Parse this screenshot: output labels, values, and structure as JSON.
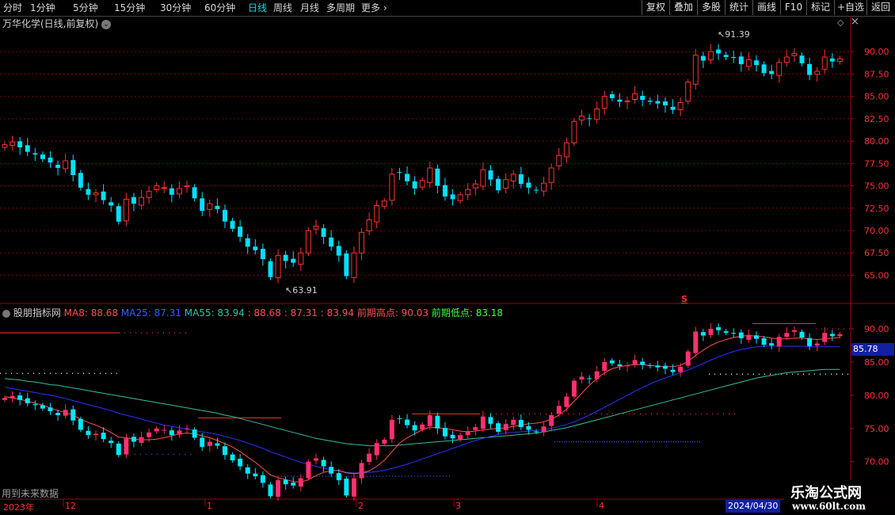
{
  "toolbar": {
    "periods": [
      "分时",
      "1分钟",
      "5分钟",
      "15分钟",
      "30分钟",
      "60分钟",
      "日线",
      "周线",
      "月线",
      "多周期",
      "更多"
    ],
    "active": "日线",
    "right_buttons": [
      "复权",
      "叠加",
      "多股",
      "统计",
      "画线",
      "F10",
      "标记",
      "+自选",
      "返回"
    ]
  },
  "main_panel": {
    "title": "万华化学(日线,前复权)",
    "high_label": "91.39",
    "low_label": "63.91",
    "s_marker": "S"
  },
  "sub_panel": {
    "indicator_name": "股朋指标网",
    "ma8_label": "MA8: 88.68",
    "ma25_label": "MA25: 87.31",
    "ma55_label": "MA55: 83.94",
    "extra1": ": 88.68",
    "extra2": ": 87.31",
    "extra3": ": 83.94",
    "prev_high_label": "前期高点: 90.03",
    "prev_low_label": "前期低点: 83.18",
    "price_box": "85.78",
    "future_note": "用到未来数据"
  },
  "time_axis": {
    "labels": [
      "2023年",
      "12",
      "1",
      "2",
      "3",
      "4"
    ],
    "current_date": "2024/04/30"
  },
  "watermark": {
    "line1": "乐淘公式网",
    "line2": "www.60lt.com"
  },
  "colors": {
    "up": "#ff3030",
    "down": "#00e0ff",
    "ma8": "#ff5050",
    "ma25": "#3030ff",
    "ma55": "#30c0a0",
    "grid": "#800000"
  },
  "chart_data": {
    "type": "candlestick",
    "main_yaxis": {
      "ticks": [
        65.0,
        67.5,
        70.0,
        72.5,
        75.0,
        77.5,
        80.0,
        82.5,
        85.0,
        87.5,
        90.0
      ],
      "ylim": [
        63.0,
        92.5
      ]
    },
    "sub_yaxis": {
      "ticks": [
        70.0,
        75.0,
        80.0,
        85.0,
        90.0
      ],
      "ylim": [
        66.5,
        91.8
      ]
    },
    "closes": [
      79.6,
      79.9,
      79.3,
      78.8,
      78.5,
      78.0,
      77.6,
      77.0,
      77.8,
      76.2,
      74.8,
      74.0,
      74.2,
      73.4,
      72.8,
      71.0,
      73.5,
      73.0,
      73.7,
      74.4,
      75.0,
      74.8,
      74.0,
      74.7,
      75.0,
      73.6,
      72.2,
      73.0,
      72.4,
      71.0,
      70.2,
      69.3,
      68.2,
      67.8,
      66.8,
      64.8,
      67.2,
      66.6,
      66.4,
      67.5,
      70.0,
      70.5,
      69.3,
      68.2,
      67.2,
      64.9,
      67.5,
      69.8,
      71.2,
      72.8,
      73.3,
      76.3,
      76.5,
      75.5,
      74.7,
      75.6,
      77.0,
      75.0,
      73.8,
      73.5,
      74.0,
      74.6,
      75.2,
      76.8,
      75.7,
      74.5,
      75.7,
      76.3,
      75.2,
      74.8,
      74.5,
      75.3,
      77.0,
      78.4,
      79.8,
      82.2,
      82.8,
      82.5,
      83.6,
      85.0,
      84.8,
      84.4,
      84.5,
      85.3,
      84.6,
      84.4,
      84.2,
      84.0,
      83.5,
      84.3,
      86.6,
      89.6,
      89.0,
      90.0,
      89.8,
      89.4,
      89.3,
      88.6,
      89.1,
      88.5,
      87.6,
      87.5,
      88.8,
      89.4,
      89.8,
      88.7,
      87.4,
      87.8,
      89.4,
      88.9,
      89.2
    ],
    "ma8": [
      79.8,
      79.6,
      79.4,
      79.1,
      78.8,
      78.5,
      78.1,
      77.7,
      77.4,
      77.0,
      76.4,
      75.9,
      75.5,
      75.0,
      74.4,
      73.7,
      73.6,
      73.4,
      73.3,
      73.3,
      73.4,
      73.6,
      73.9,
      74.2,
      74.3,
      74.2,
      73.9,
      73.6,
      73.2,
      72.7,
      72.2,
      71.5,
      70.7,
      69.9,
      69.0,
      68.0,
      67.6,
      67.3,
      67.0,
      66.9,
      67.3,
      67.9,
      68.4,
      68.6,
      68.7,
      68.3,
      68.2,
      68.3,
      68.6,
      69.3,
      70.2,
      71.5,
      72.8,
      73.6,
      74.2,
      74.8,
      75.2,
      75.1,
      75.0,
      74.8,
      74.6,
      74.5,
      74.6,
      74.8,
      74.9,
      75.0,
      75.1,
      75.3,
      75.5,
      75.7,
      75.8,
      76.0,
      76.4,
      77.0,
      77.9,
      79.1,
      80.3,
      81.5,
      82.5,
      83.4,
      84.0,
      84.3,
      84.5,
      84.6,
      84.6,
      84.5,
      84.4,
      84.3,
      84.3,
      84.5,
      85.1,
      86.0,
      86.8,
      87.5,
      88.0,
      88.4,
      88.7,
      88.9,
      89.0,
      88.9,
      88.8,
      88.6,
      88.5,
      88.5,
      88.6,
      88.6,
      88.5,
      88.4,
      88.5,
      88.6,
      88.7
    ],
    "ma25": [
      81.2,
      81.0,
      80.8,
      80.6,
      80.4,
      80.2,
      80.0,
      79.8,
      79.5,
      79.2,
      78.9,
      78.6,
      78.3,
      78.0,
      77.7,
      77.3,
      77.0,
      76.7,
      76.4,
      76.1,
      75.8,
      75.5,
      75.3,
      75.1,
      74.9,
      74.7,
      74.5,
      74.3,
      74.1,
      73.8,
      73.5,
      73.2,
      72.8,
      72.4,
      72.0,
      71.5,
      71.1,
      70.7,
      70.3,
      69.9,
      69.6,
      69.3,
      69.0,
      68.8,
      68.6,
      68.4,
      68.3,
      68.3,
      68.4,
      68.5,
      68.7,
      69.0,
      69.3,
      69.6,
      70.0,
      70.4,
      70.8,
      71.2,
      71.6,
      72.0,
      72.4,
      72.8,
      73.2,
      73.5,
      73.8,
      74.1,
      74.3,
      74.4,
      74.5,
      74.6,
      74.7,
      74.8,
      75.0,
      75.3,
      75.6,
      76.0,
      76.5,
      77.0,
      77.6,
      78.2,
      78.8,
      79.4,
      80.0,
      80.6,
      81.2,
      81.7,
      82.2,
      82.6,
      83.0,
      83.4,
      83.8,
      84.3,
      84.8,
      85.3,
      85.8,
      86.2,
      86.6,
      86.9,
      87.1,
      87.3,
      87.4,
      87.4,
      87.4,
      87.4,
      87.4,
      87.4,
      87.3,
      87.3,
      87.3,
      87.3,
      87.3
    ],
    "ma55": [
      82.5,
      82.4,
      82.3,
      82.1,
      82.0,
      81.8,
      81.6,
      81.5,
      81.3,
      81.1,
      80.9,
      80.7,
      80.5,
      80.3,
      80.1,
      79.9,
      79.7,
      79.5,
      79.3,
      79.1,
      78.9,
      78.7,
      78.5,
      78.3,
      78.1,
      77.9,
      77.7,
      77.5,
      77.3,
      77.0,
      76.8,
      76.5,
      76.2,
      75.9,
      75.6,
      75.3,
      75.0,
      74.7,
      74.4,
      74.1,
      73.8,
      73.5,
      73.3,
      73.1,
      72.9,
      72.7,
      72.6,
      72.5,
      72.4,
      72.4,
      72.4,
      72.4,
      72.5,
      72.6,
      72.7,
      72.8,
      72.9,
      73.0,
      73.1,
      73.2,
      73.3,
      73.4,
      73.5,
      73.6,
      73.7,
      73.8,
      73.9,
      74.0,
      74.1,
      74.2,
      74.3,
      74.5,
      74.7,
      74.9,
      75.1,
      75.4,
      75.7,
      76.0,
      76.3,
      76.6,
      76.9,
      77.2,
      77.5,
      77.8,
      78.1,
      78.4,
      78.7,
      79.0,
      79.3,
      79.6,
      79.9,
      80.2,
      80.5,
      80.8,
      81.1,
      81.4,
      81.7,
      82.0,
      82.3,
      82.6,
      82.8,
      83.0,
      83.2,
      83.4,
      83.5,
      83.6,
      83.7,
      83.8,
      83.9,
      83.9,
      83.9
    ]
  }
}
